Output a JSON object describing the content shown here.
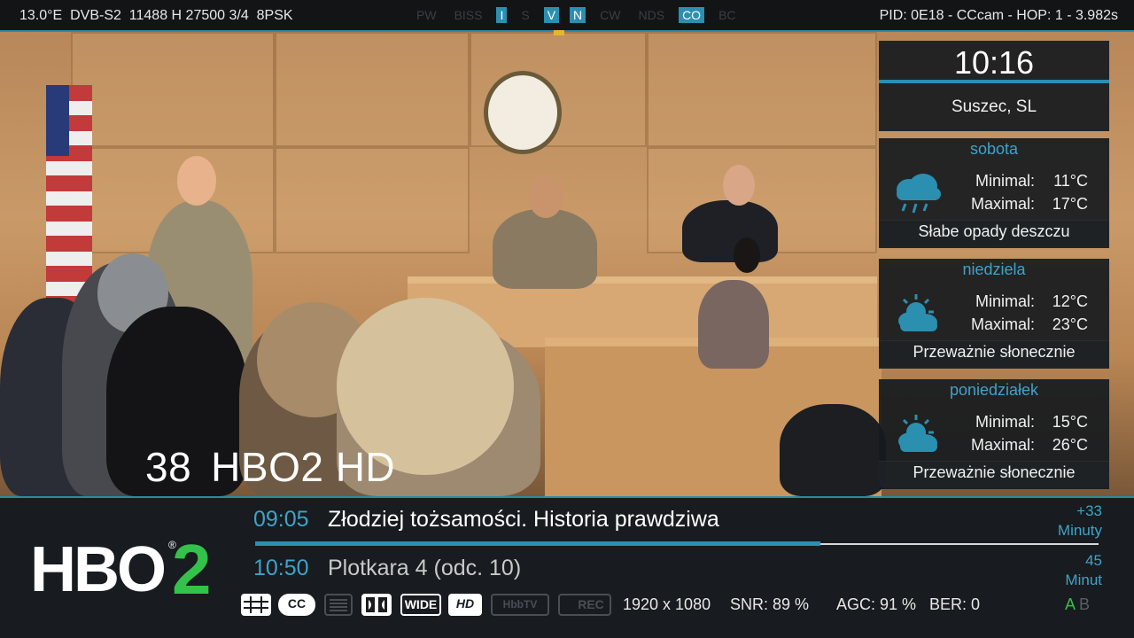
{
  "topbar": {
    "satellite": "13.0°E",
    "system": "DVB-S2",
    "transponder": "11488 H 27500 3/4",
    "modulation": "8PSK",
    "flags": [
      {
        "label": "PW",
        "active": false
      },
      {
        "label": "BISS",
        "active": false
      },
      {
        "label": "I",
        "active": true
      },
      {
        "label": "S",
        "active": false
      },
      {
        "label": "V",
        "active": true
      },
      {
        "label": "N",
        "active": true
      },
      {
        "label": "CW",
        "active": false
      },
      {
        "label": "NDS",
        "active": false
      },
      {
        "label": "CO",
        "active": true
      },
      {
        "label": "BC",
        "active": false
      }
    ],
    "pid_info": "PID: 0E18 - CCcam - HOP: 1 - 3.982s"
  },
  "weather": {
    "time": "10:16",
    "location": "Suszec, SL",
    "min_label": "Minimal:",
    "max_label": "Maximal:",
    "days": [
      {
        "day": "sobota",
        "min": "11°C",
        "max": "17°C",
        "description": "Słabe opady deszczu",
        "icon": "rain-cloud-icon"
      },
      {
        "day": "niedziela",
        "min": "12°C",
        "max": "23°C",
        "description": "Przeważnie słonecznie",
        "icon": "sun-cloud-icon"
      },
      {
        "day": "poniedziałek",
        "min": "15°C",
        "max": "26°C",
        "description": "Przeważnie słonecznie",
        "icon": "sun-cloud-icon"
      }
    ]
  },
  "channel": {
    "number": "38",
    "name": "HBO2 HD",
    "logo_text": "HBO",
    "logo_number": "2",
    "logo_registered": "®"
  },
  "epg": {
    "now": {
      "time": "09:05",
      "title": "Złodziej tożsamości. Historia prawdziwa",
      "remaining_value": "+33",
      "remaining_unit": "Minuty"
    },
    "next": {
      "time": "10:50",
      "title": "Plotkara 4 (odc. 10)",
      "remaining_value": "45",
      "remaining_unit": "Minut"
    },
    "progress": 0.67
  },
  "indicators": [
    {
      "name": "smartcard-icon",
      "active": true,
      "label": ""
    },
    {
      "name": "cc-icon",
      "active": true,
      "label": "CC"
    },
    {
      "name": "teletext-icon",
      "active": false,
      "label": ""
    },
    {
      "name": "dolby-icon",
      "active": true,
      "label": ""
    },
    {
      "name": "wide-icon",
      "active": true,
      "label": "WIDE"
    },
    {
      "name": "hd-icon",
      "active": true,
      "label": "HD"
    },
    {
      "name": "hbbtv-icon",
      "active": false,
      "label": "HbbTV"
    },
    {
      "name": "rec-icon",
      "active": false,
      "label": "REC"
    }
  ],
  "signal": {
    "resolution": "1920 x 1080",
    "snr": "SNR: 89 %",
    "agc": "AGC: 91 %",
    "ber": "BER: 0",
    "audio_a": "A",
    "audio_b": "B"
  },
  "colors": {
    "accent": "#2b8fb0",
    "logo_green": "#33c24a",
    "bar_bg": "#181b1f"
  }
}
